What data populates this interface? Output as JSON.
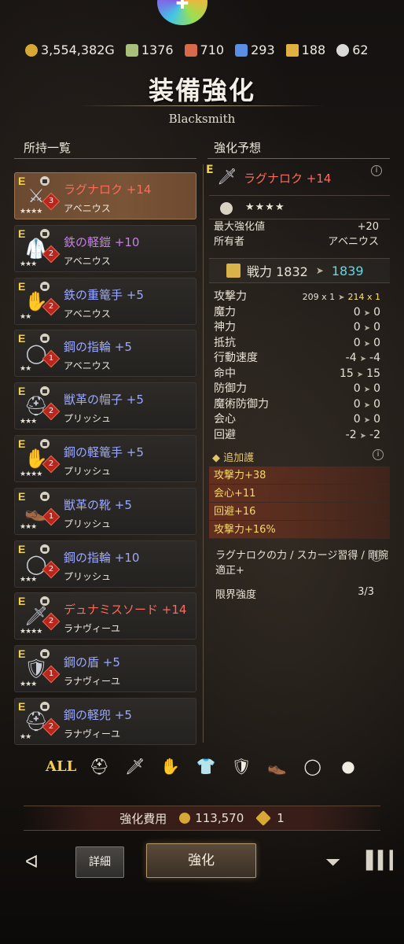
{
  "currency": [
    {
      "icon": "gold-coin-icon",
      "value": "3,554,382G",
      "color": "#d7a934"
    },
    {
      "icon": "green-ore-icon",
      "value": "1376",
      "color": "#a8c07a"
    },
    {
      "icon": "red-ore-icon",
      "value": "710",
      "color": "#d86a4a"
    },
    {
      "icon": "blue-ore-icon",
      "value": "293",
      "color": "#5a8fe6"
    },
    {
      "icon": "hammer-icon",
      "value": "188",
      "color": "#e0b040"
    },
    {
      "icon": "gem-icon",
      "value": "62",
      "color": "#d9d9d9"
    }
  ],
  "header": {
    "title": "装備強化",
    "subtitle": "Blacksmith"
  },
  "columns": {
    "owned": "所持一覧",
    "preview": "強化予想"
  },
  "items": [
    {
      "grade": "E",
      "name": "ラグナロク +14",
      "owner": "アベニウス",
      "stars": "★★★★",
      "rank": "3",
      "color": "red",
      "icon": "⚔"
    },
    {
      "grade": "E",
      "name": "鉄の軽鎧 +10",
      "owner": "アベニウス",
      "stars": "★★★",
      "rank": "2",
      "color": "purple",
      "icon": "🥼"
    },
    {
      "grade": "E",
      "name": "鉄の重篭手 +5",
      "owner": "アベニウス",
      "stars": "★★",
      "rank": "2",
      "color": "blue",
      "icon": "✋"
    },
    {
      "grade": "E",
      "name": "鋼の指輪 +5",
      "owner": "アベニウス",
      "stars": "★★",
      "rank": "1",
      "color": "blue",
      "icon": "◯"
    },
    {
      "grade": "E",
      "name": "獣革の帽子 +5",
      "owner": "プリッシュ",
      "stars": "★★★",
      "rank": "2",
      "color": "blue",
      "icon": "⛑"
    },
    {
      "grade": "E",
      "name": "鋼の軽篭手 +5",
      "owner": "プリッシュ",
      "stars": "★★★★",
      "rank": "2",
      "color": "blue",
      "icon": "✋"
    },
    {
      "grade": "E",
      "name": "獣革の靴 +5",
      "owner": "プリッシュ",
      "stars": "★★★",
      "rank": "1",
      "color": "blue",
      "icon": "👞"
    },
    {
      "grade": "E",
      "name": "鋼の指輪 +10",
      "owner": "プリッシュ",
      "stars": "★★★",
      "rank": "2",
      "color": "blue",
      "icon": "◯"
    },
    {
      "grade": "E",
      "name": "デュナミスソード +14",
      "owner": "ラナヴィーユ",
      "stars": "★★★★",
      "rank": "2",
      "color": "red",
      "icon": "🗡"
    },
    {
      "grade": "E",
      "name": "鋼の盾 +5",
      "owner": "ラナヴィーユ",
      "stars": "★★★",
      "rank": "1",
      "color": "blue",
      "icon": "🛡"
    },
    {
      "grade": "E",
      "name": "鋼の軽兜 +5",
      "owner": "ラナヴィーユ",
      "stars": "★★",
      "rank": "2",
      "color": "blue",
      "icon": "⛑"
    }
  ],
  "detail": {
    "grade": "E",
    "name": "ラグナロク +14",
    "stars": "★★★★",
    "max_label": "最大強化値",
    "max_value": "+20",
    "owner_label": "所有者",
    "owner_value": "アベニウス",
    "power_label": "戦力 1832",
    "power_new": "1839",
    "stats": [
      {
        "label": "攻撃力",
        "from": "209 x 1",
        "to": "214 x 1",
        "small": true
      },
      {
        "label": "魔力",
        "from": "0",
        "to": "0"
      },
      {
        "label": "神力",
        "from": "0",
        "to": "0"
      },
      {
        "label": "抵抗",
        "from": "0",
        "to": "0"
      },
      {
        "label": "行動速度",
        "from": "-4",
        "to": "-4"
      },
      {
        "label": "命中",
        "from": "15",
        "to": "15"
      },
      {
        "label": "防御力",
        "from": "0",
        "to": "0"
      },
      {
        "label": "魔術防御力",
        "from": "0",
        "to": "0"
      },
      {
        "label": "会心",
        "from": "0",
        "to": "0"
      },
      {
        "label": "回避",
        "from": "-2",
        "to": "-2"
      }
    ],
    "extra_head": "◆ 追加護",
    "extras": [
      "攻撃力+38",
      "会心+11",
      "回避+16",
      "攻撃力+16%"
    ],
    "skills": "ラグナロクの力 / スカージ習得 / 剛腕適正+",
    "limit_label": "限界強度",
    "limit_value": "3/3"
  },
  "filters": [
    "ALL",
    "helmet-icon",
    "sword-icon",
    "gauntlet-icon",
    "armor-icon",
    "shield-icon",
    "boots-icon",
    "ring-icon",
    "accessory-icon"
  ],
  "cost": {
    "label": "強化費用",
    "gold": "113,570",
    "hammer": "1"
  },
  "bottom": {
    "detail_label": "詳細",
    "enhance_label": "強化"
  }
}
